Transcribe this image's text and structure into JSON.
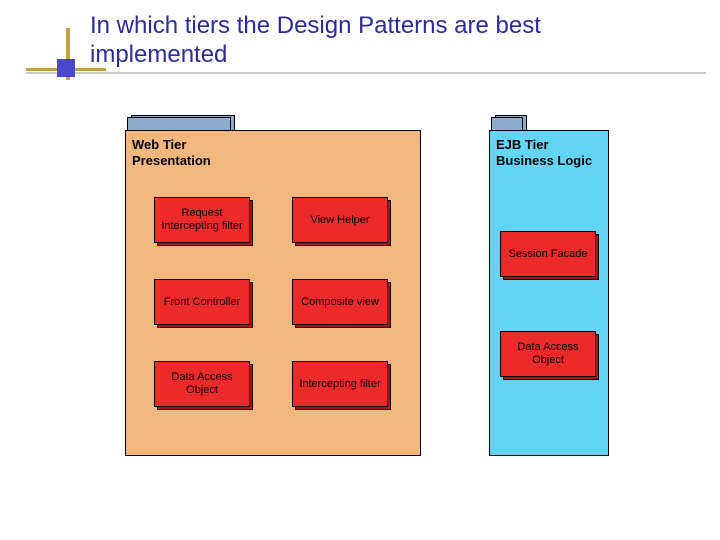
{
  "title": "In which tiers the Design Patterns are best implemented",
  "web_tier": {
    "header_line1": "Web Tier",
    "header_line2": "Presentation",
    "patterns": {
      "p1": "Request Intercepting filter",
      "p2": "View Helper",
      "p3": "Front Controller",
      "p4": "Composite view",
      "p5": "Data Access Object",
      "p6": "Intercepting filter"
    }
  },
  "ejb_tier": {
    "header_line1": "EJB Tier",
    "header_line2": "Business Logic",
    "patterns": {
      "e1": "Session Facade",
      "e2": "Data Access Object"
    }
  }
}
